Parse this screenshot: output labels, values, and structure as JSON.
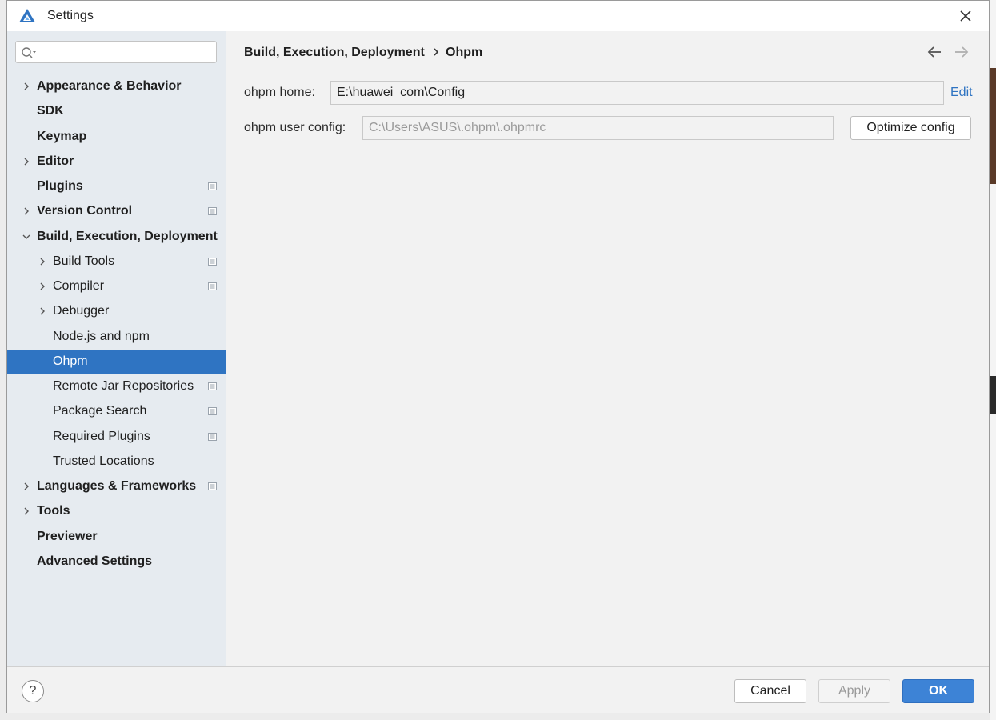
{
  "window": {
    "title": "Settings"
  },
  "search": {
    "placeholder": ""
  },
  "tree": [
    {
      "label": "Appearance & Behavior",
      "level": 0,
      "bold": true,
      "expander": "collapsed",
      "project": false,
      "selected": false
    },
    {
      "label": "SDK",
      "level": 0,
      "bold": true,
      "expander": "none",
      "project": false,
      "selected": false
    },
    {
      "label": "Keymap",
      "level": 0,
      "bold": true,
      "expander": "none",
      "project": false,
      "selected": false
    },
    {
      "label": "Editor",
      "level": 0,
      "bold": true,
      "expander": "collapsed",
      "project": false,
      "selected": false
    },
    {
      "label": "Plugins",
      "level": 0,
      "bold": true,
      "expander": "none",
      "project": true,
      "selected": false
    },
    {
      "label": "Version Control",
      "level": 0,
      "bold": true,
      "expander": "collapsed",
      "project": true,
      "selected": false
    },
    {
      "label": "Build, Execution, Deployment",
      "level": 0,
      "bold": true,
      "expander": "expanded",
      "project": false,
      "selected": false
    },
    {
      "label": "Build Tools",
      "level": 1,
      "bold": false,
      "expander": "collapsed",
      "project": true,
      "selected": false
    },
    {
      "label": "Compiler",
      "level": 1,
      "bold": false,
      "expander": "collapsed",
      "project": true,
      "selected": false
    },
    {
      "label": "Debugger",
      "level": 1,
      "bold": false,
      "expander": "collapsed",
      "project": false,
      "selected": false
    },
    {
      "label": "Node.js and npm",
      "level": 1,
      "bold": false,
      "expander": "none",
      "project": false,
      "selected": false
    },
    {
      "label": "Ohpm",
      "level": 1,
      "bold": false,
      "expander": "none",
      "project": false,
      "selected": true
    },
    {
      "label": "Remote Jar Repositories",
      "level": 1,
      "bold": false,
      "expander": "none",
      "project": true,
      "selected": false
    },
    {
      "label": "Package Search",
      "level": 1,
      "bold": false,
      "expander": "none",
      "project": true,
      "selected": false
    },
    {
      "label": "Required Plugins",
      "level": 1,
      "bold": false,
      "expander": "none",
      "project": true,
      "selected": false
    },
    {
      "label": "Trusted Locations",
      "level": 1,
      "bold": false,
      "expander": "none",
      "project": false,
      "selected": false
    },
    {
      "label": "Languages & Frameworks",
      "level": 0,
      "bold": true,
      "expander": "collapsed",
      "project": true,
      "selected": false
    },
    {
      "label": "Tools",
      "level": 0,
      "bold": true,
      "expander": "collapsed",
      "project": false,
      "selected": false
    },
    {
      "label": "Previewer",
      "level": 0,
      "bold": true,
      "expander": "none",
      "project": false,
      "selected": false
    },
    {
      "label": "Advanced Settings",
      "level": 0,
      "bold": true,
      "expander": "none",
      "project": false,
      "selected": false
    }
  ],
  "breadcrumb": {
    "parent": "Build, Execution, Deployment",
    "current": "Ohpm"
  },
  "form": {
    "home_label": "ohpm home:",
    "home_value": "E:\\huawei_com\\Config",
    "edit_label": "Edit",
    "user_config_label": "ohpm user config:",
    "user_config_value": "C:\\Users\\ASUS\\.ohpm\\.ohpmrc",
    "optimize_label": "Optimize config"
  },
  "footer": {
    "help_label": "?",
    "cancel_label": "Cancel",
    "apply_label": "Apply",
    "ok_label": "OK"
  },
  "colors": {
    "accent": "#2f74c2",
    "sidebar_bg": "#e6ebf0",
    "selected_bg": "#2f74c2"
  }
}
